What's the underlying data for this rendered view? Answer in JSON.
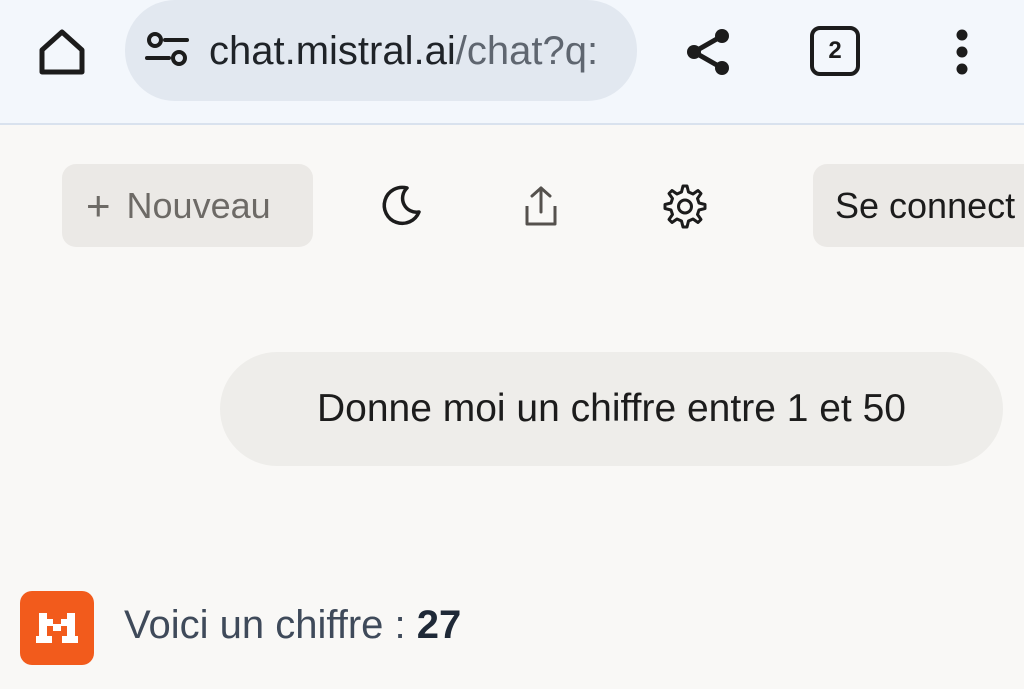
{
  "browser": {
    "url_host": "chat.mistral.ai",
    "url_path": "/chat?q:",
    "tab_count": "2",
    "icons": {
      "home": "home-icon",
      "site_settings": "tune-icon",
      "share": "share-icon",
      "menu": "more-vertical-icon"
    }
  },
  "toolbar": {
    "new_plus": "+",
    "new_label": "Nouveau",
    "login_label": "Se connect",
    "icons": {
      "theme": "moon-icon",
      "share": "upload-icon",
      "settings": "gear-icon"
    }
  },
  "chat": {
    "user_message": "Donne moi un chiffre entre 1 et 50",
    "assistant_prefix": "Voici un chiffre : ",
    "assistant_number": "27",
    "avatar_color": "#f25b1c"
  }
}
